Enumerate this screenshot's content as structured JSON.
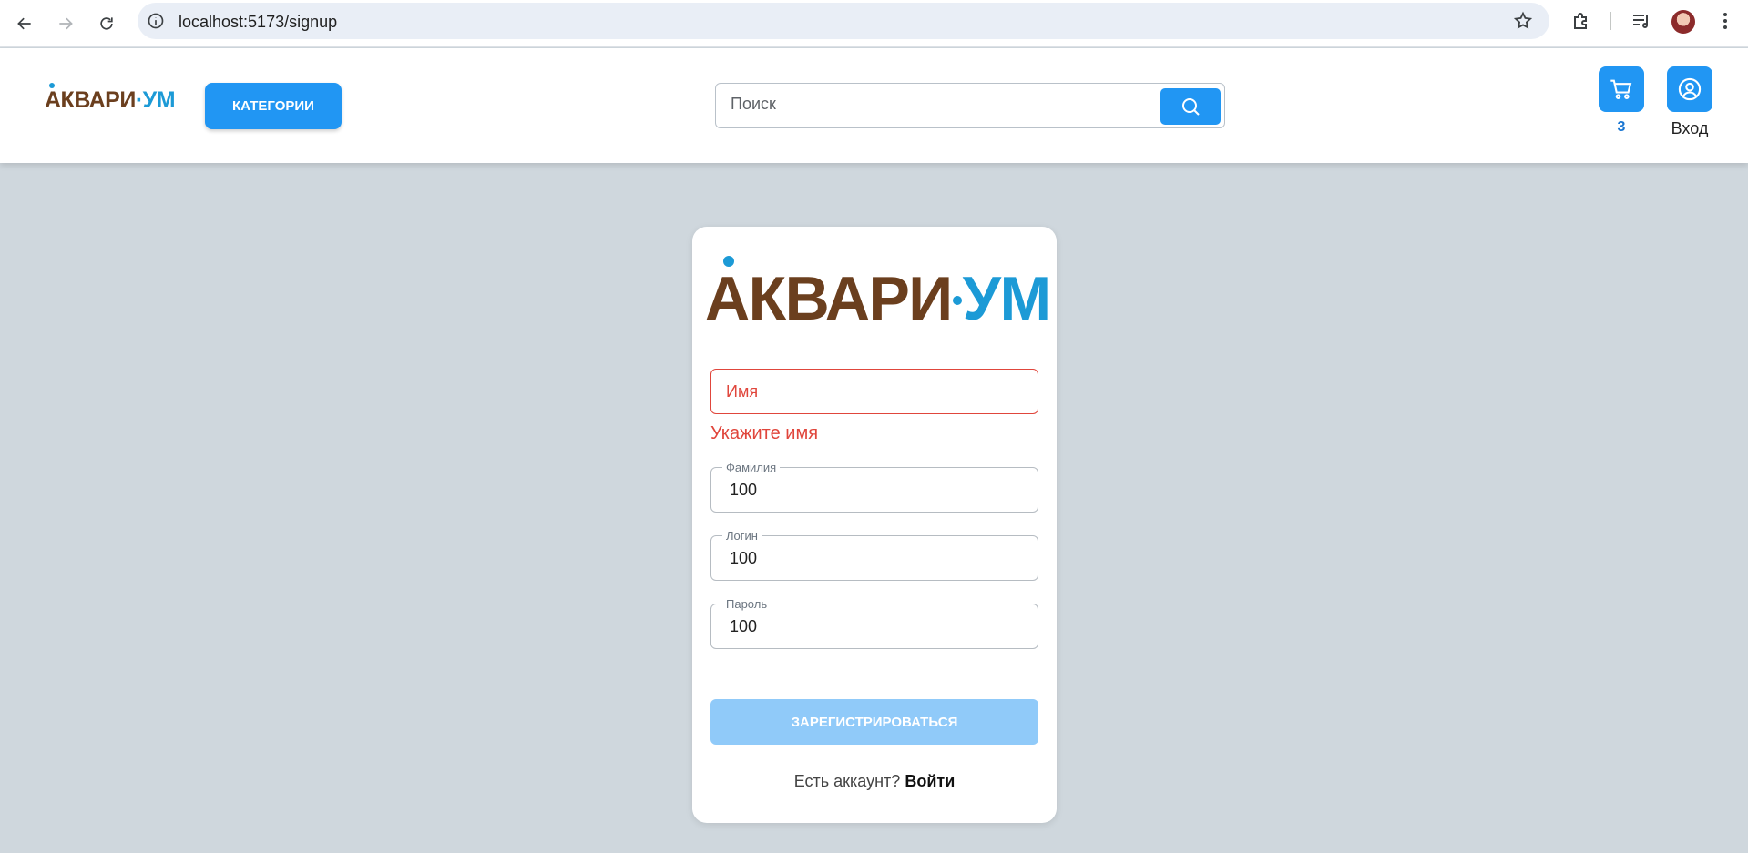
{
  "browser": {
    "url": "localhost:5173/signup"
  },
  "header": {
    "logo": {
      "part1": "АКВАРИ",
      "part2": "УМ"
    },
    "categories_label": "КАТЕГОРИИ",
    "search_placeholder": "Поиск",
    "cart_count": "3",
    "login_label": "Вход"
  },
  "signup": {
    "logo": {
      "part1": "АКВАРИ",
      "part2": "УМ"
    },
    "name": {
      "placeholder": "Имя",
      "error": "Укажите имя"
    },
    "surname": {
      "label": "Фамилия",
      "value": "100"
    },
    "login": {
      "label": "Логин",
      "value": "100"
    },
    "password": {
      "label": "Пароль",
      "value": "100"
    },
    "submit_label": "ЗАРЕГИСТРИРОВАТЬСЯ",
    "have_account": "Есть аккаунт?",
    "signin_link": "Войти"
  },
  "colors": {
    "primary": "#2196f3",
    "primary_disabled": "#90caf9",
    "error": "#e0463c",
    "logo_brown": "#6b3f1e",
    "logo_blue": "#1c9ad6",
    "page_bg": "#cfd7dd"
  }
}
